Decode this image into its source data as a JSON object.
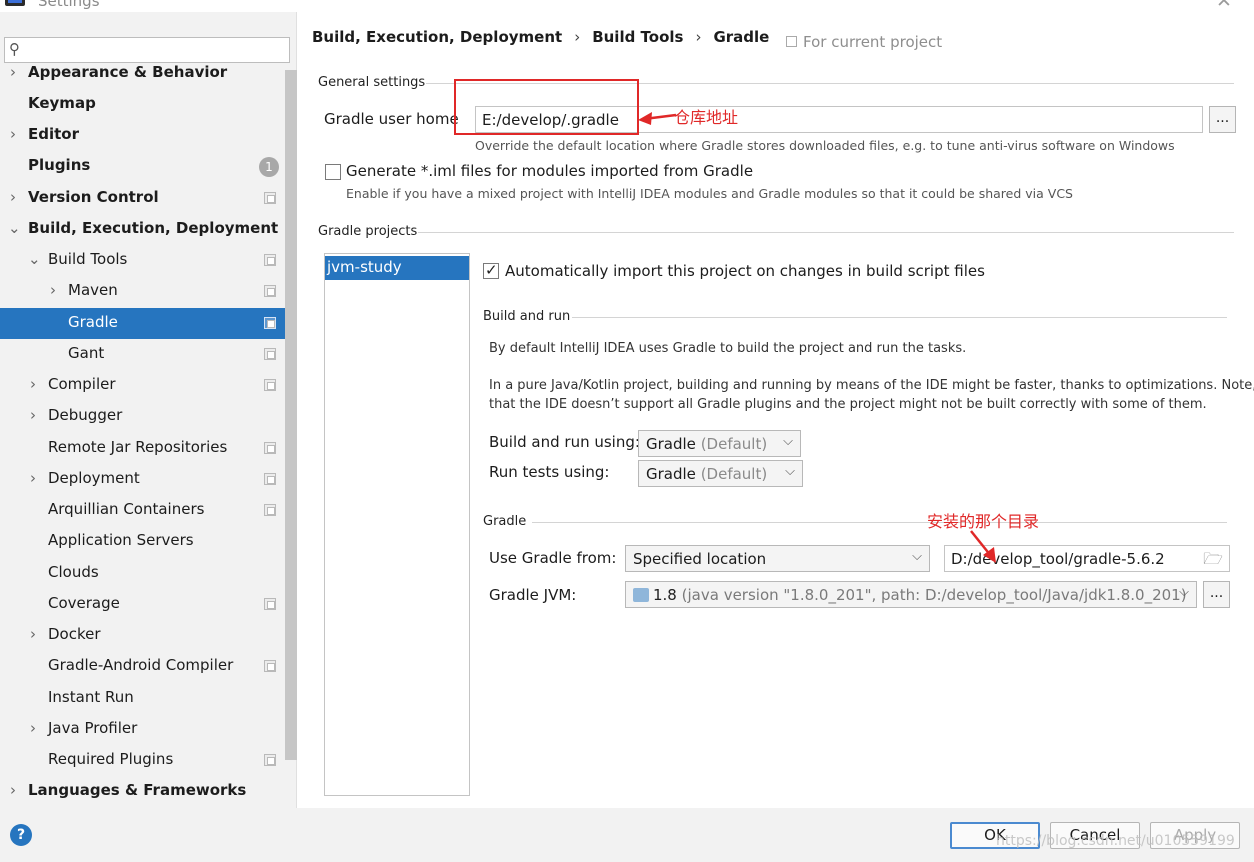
{
  "window": {
    "title": "Settings",
    "close_icon": "close-icon"
  },
  "sidebar": {
    "search": {
      "value": "",
      "placeholder": ""
    },
    "items": [
      {
        "label": "Appearance & Behavior"
      },
      {
        "label": "Keymap"
      },
      {
        "label": "Editor"
      },
      {
        "label": "Plugins",
        "badge": "1"
      },
      {
        "label": "Version Control"
      },
      {
        "label": "Build, Execution, Deployment"
      },
      {
        "label": "Build Tools"
      },
      {
        "label": "Maven"
      },
      {
        "label": "Gradle"
      },
      {
        "label": "Gant"
      },
      {
        "label": "Compiler"
      },
      {
        "label": "Debugger"
      },
      {
        "label": "Remote Jar Repositories"
      },
      {
        "label": "Deployment"
      },
      {
        "label": "Arquillian Containers"
      },
      {
        "label": "Application Servers"
      },
      {
        "label": "Clouds"
      },
      {
        "label": "Coverage"
      },
      {
        "label": "Docker"
      },
      {
        "label": "Gradle-Android Compiler"
      },
      {
        "label": "Instant Run"
      },
      {
        "label": "Java Profiler"
      },
      {
        "label": "Required Plugins"
      },
      {
        "label": "Languages & Frameworks"
      }
    ]
  },
  "breadcrumb": [
    "Build, Execution, Deployment",
    "Build Tools",
    "Gradle"
  ],
  "breadcrumb_sep": "›",
  "scope_hint": "For current project",
  "general": {
    "section": "General settings",
    "user_home_label": "Gradle user home",
    "user_home_value": "E:/develop/.gradle",
    "user_home_hint": "Override the default location where Gradle stores downloaded files, e.g. to tune anti-virus software on Windows",
    "browse_label": "...",
    "iml_label": "Generate *.iml files for modules imported from Gradle",
    "iml_hint": "Enable if you have a mixed project with IntelliJ IDEA modules and Gradle modules so that it could be shared via VCS",
    "iml_checked": false
  },
  "projects": {
    "section": "Gradle projects",
    "items": [
      "jvm-study"
    ],
    "auto_import_label": "Automatically import this project on changes in build script files",
    "auto_import_checked": true
  },
  "build_run": {
    "section": "Build and run",
    "info1": "By default IntelliJ IDEA uses Gradle to build the project and run the tasks.",
    "info2": "In a pure Java/Kotlin project, building and running by means of the IDE might be faster, thanks to optimizations. Note,",
    "info3": "that the IDE doesn’t support all Gradle plugins and the project might not be built correctly with some of them.",
    "using_label": "Build and run using:",
    "using_value": "Gradle",
    "using_suffix": "(Default)",
    "tests_label": "Run tests using:",
    "tests_value": "Gradle",
    "tests_suffix": "(Default)"
  },
  "gradle": {
    "section": "Gradle",
    "use_from_label": "Use Gradle from:",
    "use_from_value": "Specified location",
    "location_value": "D:/develop_tool/gradle-5.6.2",
    "jvm_label": "Gradle JVM:",
    "jvm_version": "1.8",
    "jvm_detail": "(java version \"1.8.0_201\", path: D:/develop_tool/Java/jdk1.8.0_201)",
    "browse_label": "..."
  },
  "annotations": {
    "repo_address": "仓库地址",
    "install_dir": "安装的那个目录"
  },
  "buttons": {
    "help": "?",
    "ok": "OK",
    "cancel": "Cancel",
    "apply": "Apply"
  },
  "watermark": "https://blog.csdn.net/u010559199",
  "colors": {
    "accent": "#2675bf",
    "annotation": "#e02828",
    "sidebar_bg": "#f2f2f2"
  }
}
